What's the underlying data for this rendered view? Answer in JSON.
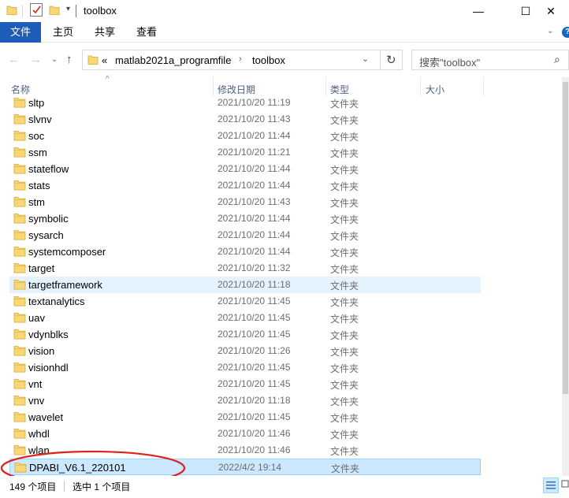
{
  "window": {
    "title": "toolbox",
    "minimize": "—",
    "maximize": "☐",
    "close": "✕"
  },
  "ribbon": {
    "tabs": [
      "文件",
      "主页",
      "共享",
      "查看"
    ]
  },
  "address": {
    "overflow": "«",
    "crumbs": [
      "matlab2021a_programfile",
      "toolbox"
    ],
    "search_placeholder": "搜索\"toolbox\""
  },
  "columns": {
    "name": "名称",
    "date": "修改日期",
    "type": "类型",
    "size": "大小"
  },
  "files": [
    {
      "name": "sltp",
      "date": "2021/10/20 11:19",
      "type": "文件夹"
    },
    {
      "name": "slvnv",
      "date": "2021/10/20 11:43",
      "type": "文件夹"
    },
    {
      "name": "soc",
      "date": "2021/10/20 11:44",
      "type": "文件夹"
    },
    {
      "name": "ssm",
      "date": "2021/10/20 11:21",
      "type": "文件夹"
    },
    {
      "name": "stateflow",
      "date": "2021/10/20 11:44",
      "type": "文件夹"
    },
    {
      "name": "stats",
      "date": "2021/10/20 11:44",
      "type": "文件夹"
    },
    {
      "name": "stm",
      "date": "2021/10/20 11:43",
      "type": "文件夹"
    },
    {
      "name": "symbolic",
      "date": "2021/10/20 11:44",
      "type": "文件夹"
    },
    {
      "name": "sysarch",
      "date": "2021/10/20 11:44",
      "type": "文件夹"
    },
    {
      "name": "systemcomposer",
      "date": "2021/10/20 11:44",
      "type": "文件夹"
    },
    {
      "name": "target",
      "date": "2021/10/20 11:32",
      "type": "文件夹"
    },
    {
      "name": "targetframework",
      "date": "2021/10/20 11:18",
      "type": "文件夹"
    },
    {
      "name": "textanalytics",
      "date": "2021/10/20 11:45",
      "type": "文件夹"
    },
    {
      "name": "uav",
      "date": "2021/10/20 11:45",
      "type": "文件夹"
    },
    {
      "name": "vdynblks",
      "date": "2021/10/20 11:45",
      "type": "文件夹"
    },
    {
      "name": "vision",
      "date": "2021/10/20 11:26",
      "type": "文件夹"
    },
    {
      "name": "visionhdl",
      "date": "2021/10/20 11:45",
      "type": "文件夹"
    },
    {
      "name": "vnt",
      "date": "2021/10/20 11:45",
      "type": "文件夹"
    },
    {
      "name": "vnv",
      "date": "2021/10/20 11:18",
      "type": "文件夹"
    },
    {
      "name": "wavelet",
      "date": "2021/10/20 11:45",
      "type": "文件夹"
    },
    {
      "name": "whdl",
      "date": "2021/10/20 11:46",
      "type": "文件夹"
    },
    {
      "name": "wlan",
      "date": "2021/10/20 11:46",
      "type": "文件夹"
    },
    {
      "name": "DPABI_V6.1_220101",
      "date": "2022/4/2 19:14",
      "type": "文件夹"
    }
  ],
  "status": {
    "item_count": "149 个项目",
    "selection": "选中 1 个项目"
  },
  "colors": {
    "file_tab": "#1f5bb8",
    "folder": "#f8d775",
    "selection": "#cce8ff",
    "hover": "#e5f3ff",
    "annotation": "#e0201c"
  }
}
